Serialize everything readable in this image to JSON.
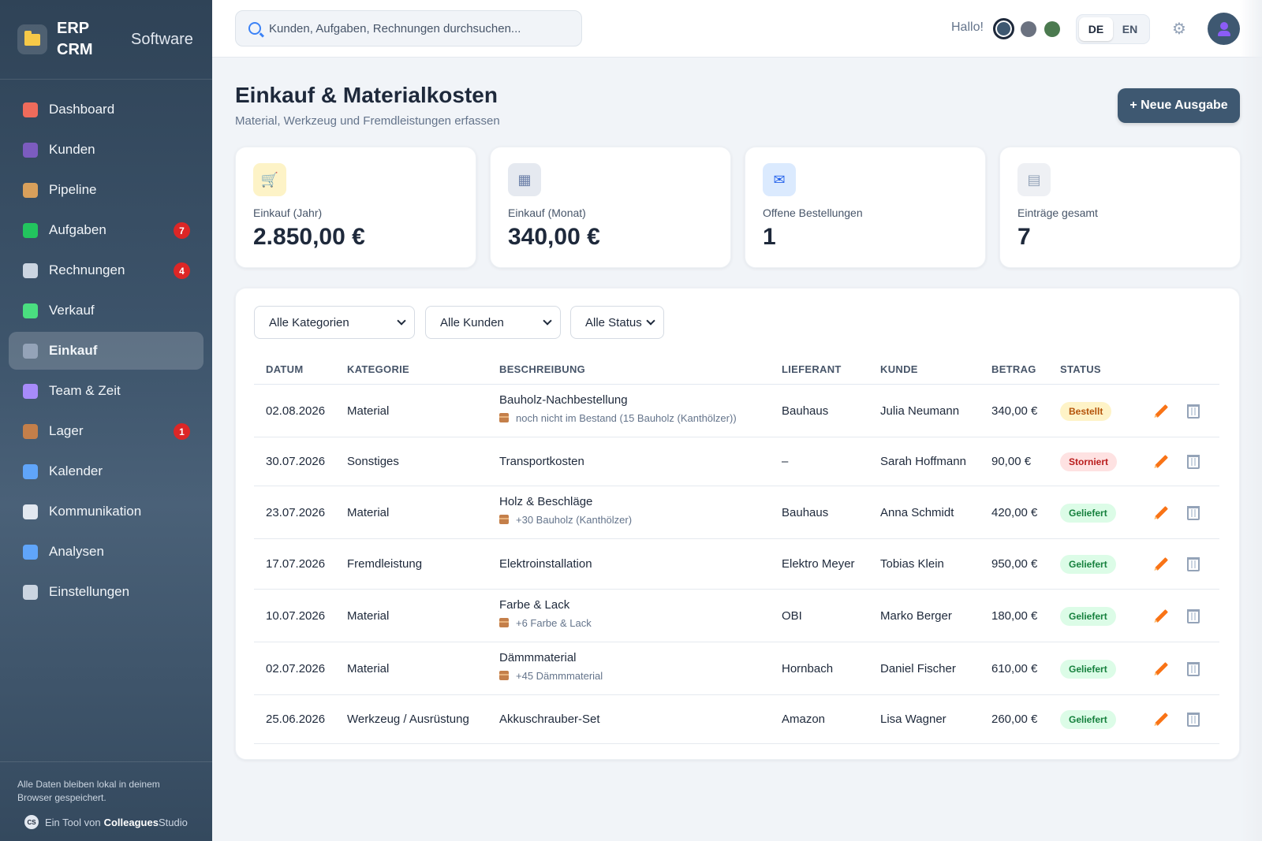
{
  "brand": {
    "name": "ERP CRM",
    "subtitle": "Software"
  },
  "sidebar": {
    "items": [
      {
        "label": "Dashboard",
        "icon": "bar-chart-icon",
        "color": "#ef6b5b",
        "badge": null,
        "active": false
      },
      {
        "label": "Kunden",
        "icon": "users-icon",
        "color": "#7c5cbf",
        "badge": null,
        "active": false
      },
      {
        "label": "Pipeline",
        "icon": "compass-icon",
        "color": "#d9a05b",
        "badge": null,
        "active": false
      },
      {
        "label": "Aufgaben",
        "icon": "checkbox-icon",
        "color": "#22c55e",
        "badge": "7",
        "active": false
      },
      {
        "label": "Rechnungen",
        "icon": "receipt-icon",
        "color": "#cbd5e1",
        "badge": "4",
        "active": false
      },
      {
        "label": "Verkauf",
        "icon": "chart-up-icon",
        "color": "#4ade80",
        "badge": null,
        "active": false
      },
      {
        "label": "Einkauf",
        "icon": "keyboard-icon",
        "color": "#94a3b8",
        "badge": null,
        "active": true
      },
      {
        "label": "Team & Zeit",
        "icon": "stopwatch-icon",
        "color": "#a78bfa",
        "badge": null,
        "active": false
      },
      {
        "label": "Lager",
        "icon": "package-icon",
        "color": "#c47f4a",
        "badge": "1",
        "active": false
      },
      {
        "label": "Kalender",
        "icon": "calendar-icon",
        "color": "#60a5fa",
        "badge": null,
        "active": false
      },
      {
        "label": "Kommunikation",
        "icon": "speech-bubble-icon",
        "color": "#e2e8f0",
        "badge": null,
        "active": false
      },
      {
        "label": "Analysen",
        "icon": "line-chart-icon",
        "color": "#60a5fa",
        "badge": null,
        "active": false
      },
      {
        "label": "Einstellungen",
        "icon": "gear-icon",
        "color": "#cbd5e1",
        "badge": null,
        "active": false
      }
    ],
    "footer_note": "Alle Daten bleiben lokal in deinem Browser gespeichert.",
    "credit_prefix": "Ein Tool von",
    "credit_brand": "Colleagues",
    "credit_brand_suffix": "Studio",
    "credit_logo": "CS"
  },
  "header": {
    "search_placeholder": "Kunden, Aufgaben, Rechnungen durchsuchen...",
    "greeting": "Hallo!",
    "theme_colors": [
      "#3e5871",
      "#6b7280",
      "#4b7a4f"
    ],
    "lang_options": [
      "DE",
      "EN"
    ],
    "lang_active": "DE"
  },
  "page": {
    "title": "Einkauf & Materialkosten",
    "subtitle": "Material, Werkzeug und Fremdleistungen erfassen",
    "new_button": "+ Neue Ausgabe"
  },
  "stats": [
    {
      "label": "Einkauf (Jahr)",
      "value": "2.850,00 €",
      "icon": "shopping-cart-icon",
      "bg": "#fdf3c7"
    },
    {
      "label": "Einkauf (Monat)",
      "value": "340,00 €",
      "icon": "calendar-icon",
      "bg": "#e5e9f0"
    },
    {
      "label": "Offene Bestellungen",
      "value": "1",
      "icon": "mailbox-icon",
      "bg": "#dbeafe"
    },
    {
      "label": "Einträge gesamt",
      "value": "7",
      "icon": "receipt-icon",
      "bg": "#eef0f4"
    }
  ],
  "filters": [
    "Alle Kategorien",
    "Alle Kunden",
    "Alle Status"
  ],
  "table": {
    "columns": [
      "DATUM",
      "KATEGORIE",
      "BESCHREIBUNG",
      "LIEFERANT",
      "KUNDE",
      "BETRAG",
      "STATUS"
    ],
    "rows": [
      {
        "date": "02.08.2026",
        "category": "Material",
        "description": "Bauholz-Nachbestellung",
        "note": "noch nicht im Bestand (15 Bauholz (Kanthölzer))",
        "supplier": "Bauhaus",
        "customer": "Julia Neumann",
        "amount": "340,00 €",
        "status": "Bestellt"
      },
      {
        "date": "30.07.2026",
        "category": "Sonstiges",
        "description": "Transportkosten",
        "note": null,
        "supplier": "–",
        "customer": "Sarah Hoffmann",
        "amount": "90,00 €",
        "status": "Storniert"
      },
      {
        "date": "23.07.2026",
        "category": "Material",
        "description": "Holz & Beschläge",
        "note": "+30 Bauholz (Kanthölzer)",
        "supplier": "Bauhaus",
        "customer": "Anna Schmidt",
        "amount": "420,00 €",
        "status": "Geliefert"
      },
      {
        "date": "17.07.2026",
        "category": "Fremdleistung",
        "description": "Elektroinstallation",
        "note": null,
        "supplier": "Elektro Meyer",
        "customer": "Tobias Klein",
        "amount": "950,00 €",
        "status": "Geliefert"
      },
      {
        "date": "10.07.2026",
        "category": "Material",
        "description": "Farbe & Lack",
        "note": "+6 Farbe & Lack",
        "supplier": "OBI",
        "customer": "Marko Berger",
        "amount": "180,00 €",
        "status": "Geliefert"
      },
      {
        "date": "02.07.2026",
        "category": "Material",
        "description": "Dämmmaterial",
        "note": "+45 Dämmmaterial",
        "supplier": "Hornbach",
        "customer": "Daniel Fischer",
        "amount": "610,00 €",
        "status": "Geliefert"
      },
      {
        "date": "25.06.2026",
        "category": "Werkzeug / Ausrüstung",
        "description": "Akkuschrauber-Set",
        "note": null,
        "supplier": "Amazon",
        "customer": "Lisa Wagner",
        "amount": "260,00 €",
        "status": "Geliefert"
      }
    ],
    "status_colors": {
      "Bestellt": {
        "bg": "#fef3c7",
        "fg": "#b45309"
      },
      "Storniert": {
        "bg": "#fee2e2",
        "fg": "#b91c1c"
      },
      "Geliefert": {
        "bg": "#dcfce7",
        "fg": "#15803d"
      }
    }
  }
}
